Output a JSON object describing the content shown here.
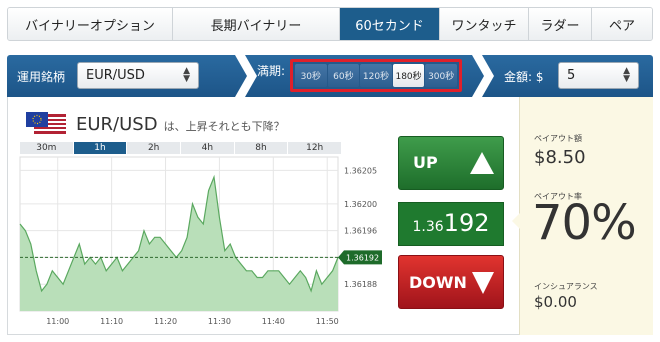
{
  "tabs": [
    {
      "label": "バイナリーオプション",
      "active": false
    },
    {
      "label": "長期バイナリー",
      "active": false
    },
    {
      "label": "60セカンド",
      "active": true
    },
    {
      "label": "ワンタッチ",
      "active": false
    },
    {
      "label": "ラダー",
      "active": false
    },
    {
      "label": "ペア",
      "active": false
    }
  ],
  "bar": {
    "asset_label": "運用銘柄",
    "asset_value": "EUR/USD",
    "expiry_label": "満期:",
    "expiry_options": [
      "30秒",
      "60秒",
      "120秒",
      "180秒",
      "300秒"
    ],
    "expiry_selected": "180秒",
    "amount_label": "金額: $",
    "amount_value": "5"
  },
  "asset": {
    "pair": "EUR/USD",
    "question": "は、上昇それとも下降？"
  },
  "timeframes": [
    {
      "label": "30m",
      "active": false
    },
    {
      "label": "1h",
      "active": true
    },
    {
      "label": "2h",
      "active": false
    },
    {
      "label": "4h",
      "active": false
    },
    {
      "label": "8h",
      "active": false
    },
    {
      "label": "12h",
      "active": false
    }
  ],
  "trade": {
    "up_label": "UP",
    "down_label": "DOWN",
    "price_small": "1.36",
    "price_big": "192"
  },
  "info": {
    "payout_label": "ペイアウト額",
    "payout_value": "$8.50",
    "rate_label": "ペイアウト率",
    "rate_value": "70%",
    "insurance_label": "インシュアランス",
    "insurance_value": "$0.00"
  },
  "colors": {
    "tab_active": "#1d5d8c",
    "bar_blue": "#2a6aa0",
    "up_green": "#2e8a3c",
    "down_red": "#c8202a",
    "price_green": "#1f7a2f",
    "info_bg": "#fbf8e4",
    "highlight_red": "#e0202a"
  },
  "chart_data": {
    "type": "area",
    "y_ticks": [
      "1.36205",
      "1.36200",
      "1.36196",
      "1.36192",
      "1.36188"
    ],
    "x_ticks": [
      "11:00",
      "11:10",
      "11:20",
      "11:30",
      "11:40",
      "11:50"
    ],
    "current_label": "1.36192",
    "x": [
      "10:53",
      "10:54",
      "10:55",
      "10:56",
      "10:57",
      "10:58",
      "10:59",
      "11:00",
      "11:01",
      "11:02",
      "11:03",
      "11:04",
      "11:05",
      "11:06",
      "11:07",
      "11:08",
      "11:09",
      "11:10",
      "11:11",
      "11:12",
      "11:13",
      "11:14",
      "11:15",
      "11:16",
      "11:17",
      "11:18",
      "11:19",
      "11:20",
      "11:21",
      "11:22",
      "11:23",
      "11:24",
      "11:25",
      "11:26",
      "11:27",
      "11:28",
      "11:29",
      "11:30",
      "11:31",
      "11:32",
      "11:33",
      "11:34",
      "11:35",
      "11:36",
      "11:37",
      "11:38",
      "11:39",
      "11:40",
      "11:41",
      "11:42",
      "11:43",
      "11:44",
      "11:45",
      "11:46",
      "11:47",
      "11:48",
      "11:49",
      "11:50",
      "11:51",
      "11:52"
    ],
    "series": [
      {
        "values": [
          1.36197,
          1.36196,
          1.36194,
          1.3619,
          1.36187,
          1.36188,
          1.3619,
          1.36189,
          1.36188,
          1.3619,
          1.36192,
          1.36194,
          1.36191,
          1.36192,
          1.36191,
          1.36192,
          1.3619,
          1.36191,
          1.36192,
          1.3619,
          1.36191,
          1.36192,
          1.36193,
          1.36196,
          1.36194,
          1.36195,
          1.36195,
          1.36194,
          1.36193,
          1.36192,
          1.36193,
          1.36195,
          1.362,
          1.36198,
          1.36197,
          1.36202,
          1.36204,
          1.36198,
          1.36193,
          1.36194,
          1.36192,
          1.36191,
          1.3619,
          1.3619,
          1.36189,
          1.36189,
          1.3619,
          1.3619,
          1.3619,
          1.36189,
          1.36188,
          1.36189,
          1.3619,
          1.36189,
          1.36187,
          1.3619,
          1.36188,
          1.36189,
          1.3619,
          1.36192
        ]
      }
    ],
    "ylim": [
      1.36184,
      1.36207
    ],
    "grid": true
  }
}
